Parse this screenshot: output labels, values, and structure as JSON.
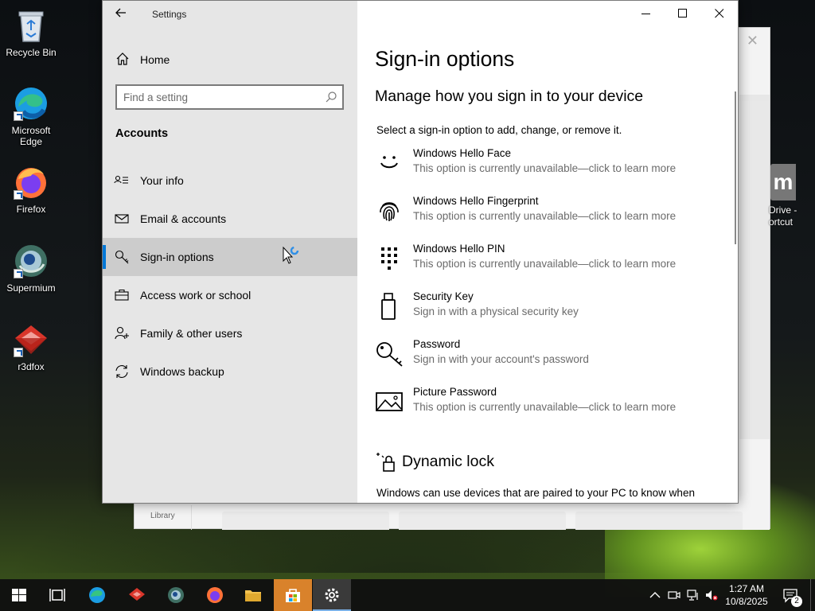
{
  "desktop": {
    "icons": [
      {
        "label": "Recycle Bin"
      },
      {
        "label": "Microsoft Edge"
      },
      {
        "label": "Firefox"
      },
      {
        "label": "Supermium"
      },
      {
        "label": "r3dfox"
      }
    ],
    "partial_icon_label": "Drive - ortcut",
    "partial_icon_letter": "m"
  },
  "background_window": {
    "sidebar_label": "Library"
  },
  "settings": {
    "title": "Settings",
    "home_label": "Home",
    "search_placeholder": "Find a setting",
    "section_header": "Accounts",
    "nav_items": [
      {
        "label": "Your info",
        "icon": "person-card-icon",
        "selected": false
      },
      {
        "label": "Email & accounts",
        "icon": "mail-icon",
        "selected": false
      },
      {
        "label": "Sign-in options",
        "icon": "key-icon",
        "selected": true
      },
      {
        "label": "Access work or school",
        "icon": "briefcase-icon",
        "selected": false
      },
      {
        "label": "Family & other users",
        "icon": "person-add-icon",
        "selected": false
      },
      {
        "label": "Windows backup",
        "icon": "sync-icon",
        "selected": false
      }
    ],
    "page_title": "Sign-in options",
    "subtitle": "Manage how you sign in to your device",
    "description": "Select a sign-in option to add, change, or remove it.",
    "options": [
      {
        "name": "Windows Hello Face",
        "status": "This option is currently unavailable—click to learn more",
        "icon": "face-icon"
      },
      {
        "name": "Windows Hello Fingerprint",
        "status": "This option is currently unavailable—click to learn more",
        "icon": "fingerprint-icon"
      },
      {
        "name": "Windows Hello PIN",
        "status": "This option is currently unavailable—click to learn more",
        "icon": "pin-keypad-icon"
      },
      {
        "name": "Security Key",
        "status": "Sign in with a physical security key",
        "icon": "usb-key-icon"
      },
      {
        "name": "Password",
        "status": "Sign in with your account's password",
        "icon": "password-key-icon"
      },
      {
        "name": "Picture Password",
        "status": "This option is currently unavailable—click to learn more",
        "icon": "picture-icon"
      }
    ],
    "dynamic_lock": {
      "title": "Dynamic lock",
      "description": "Windows can use devices that are paired to your PC to know when"
    }
  },
  "taskbar": {
    "apps": [
      "start",
      "task-view",
      "edge",
      "r3dfox",
      "supermium",
      "firefox",
      "file-explorer",
      "microsoft-store",
      "settings"
    ],
    "time": "1:27 AM",
    "date": "10/8/2025",
    "notification_count": "2"
  },
  "colors": {
    "accent": "#0078d7",
    "nav_bg": "#e6e6e6",
    "selected_bg": "#cccccc",
    "store_highlight": "#d9822b"
  }
}
